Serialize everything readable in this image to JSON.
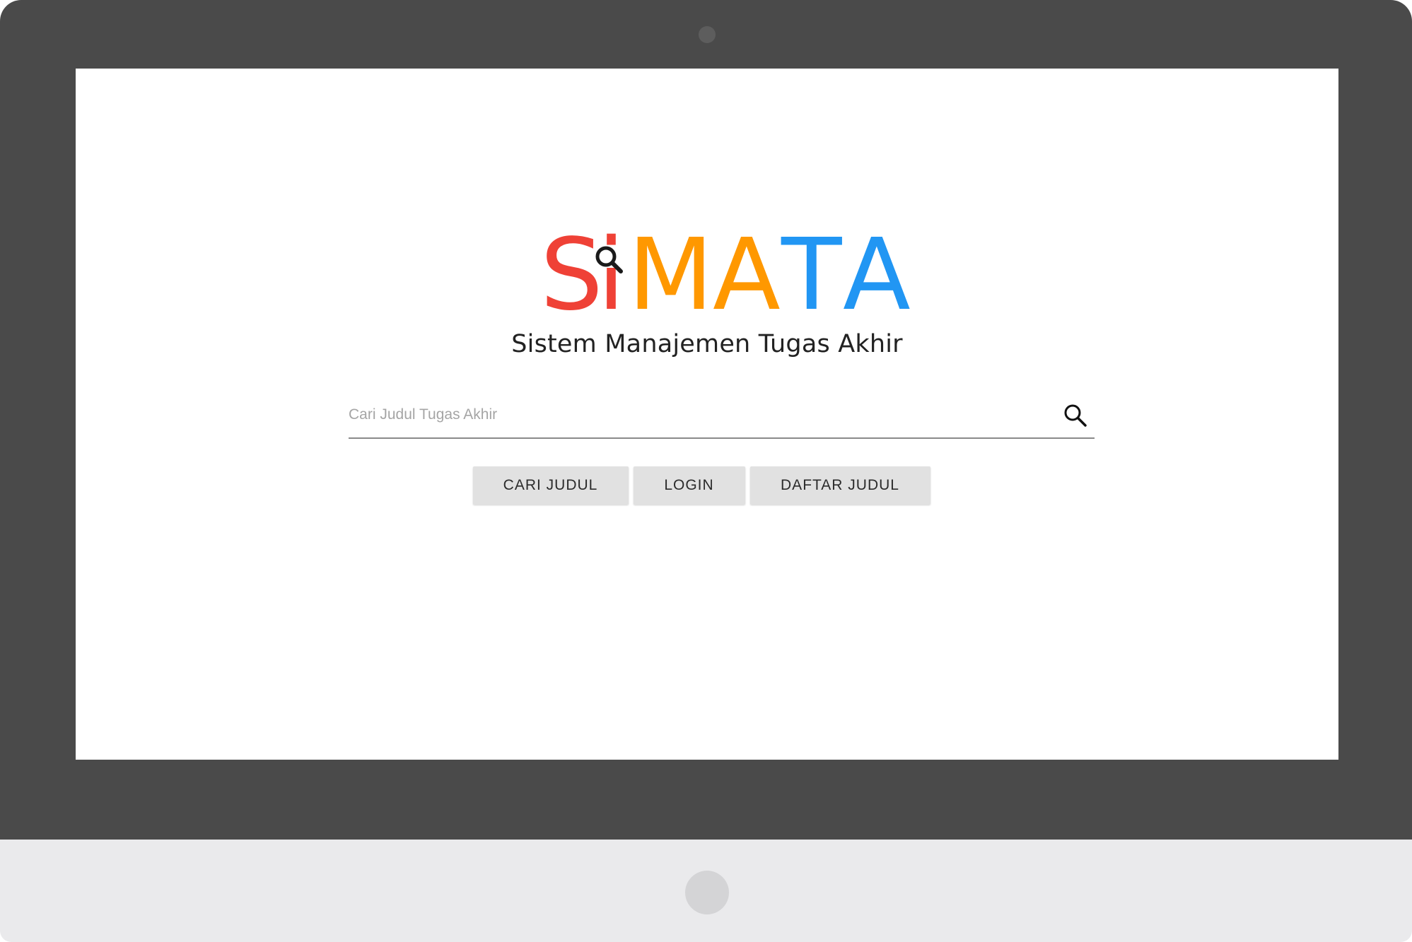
{
  "logo": {
    "letters": [
      "S",
      "i",
      "M",
      "A",
      "T",
      "A"
    ],
    "colors": {
      "red": "#ef4136",
      "orange": "#ff9800",
      "blue": "#2196f3",
      "icon": "#1a1a1a"
    }
  },
  "subtitle": "Sistem Manajemen Tugas Akhir",
  "search": {
    "placeholder": "Cari Judul Tugas Akhir",
    "value": ""
  },
  "buttons": {
    "cari": "CARI JUDUL",
    "login": "LOGIN",
    "daftar": "DAFTAR JUDUL"
  },
  "colors": {
    "bezel": "#4a4a4a",
    "chin": "#eaeaec",
    "button_bg": "#e1e1e1"
  }
}
